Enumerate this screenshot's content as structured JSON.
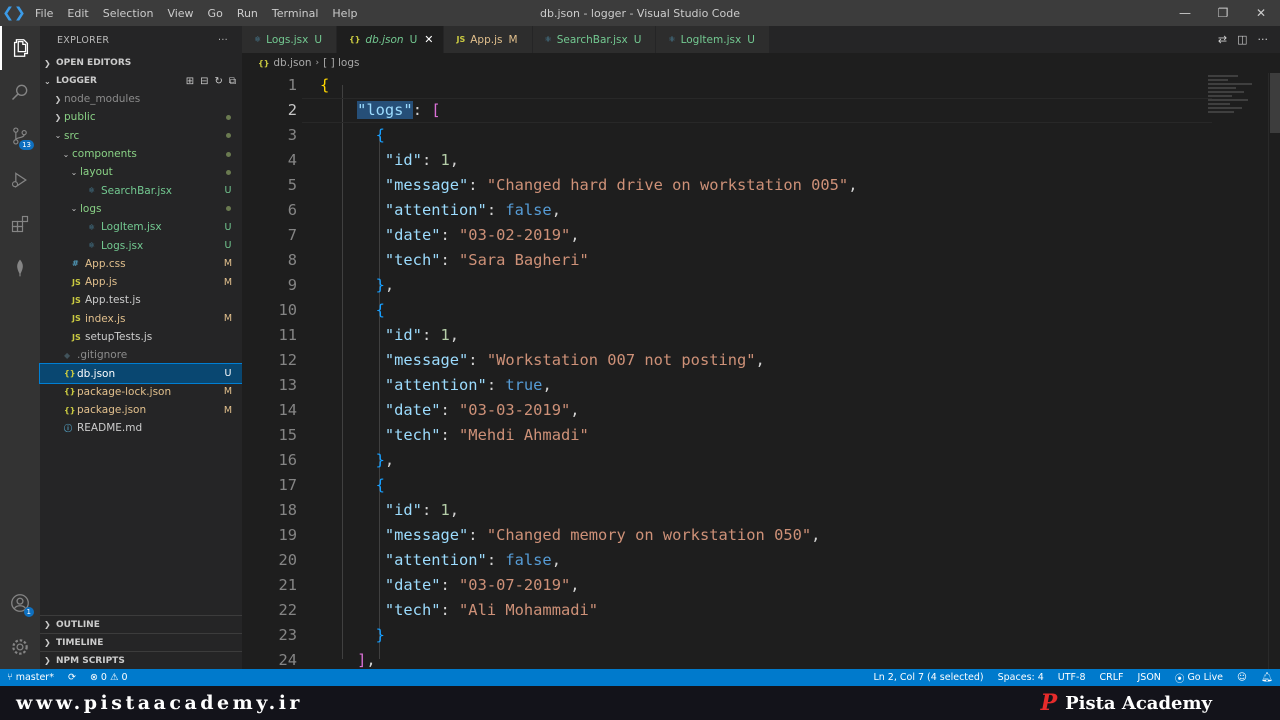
{
  "window": {
    "title": "db.json - logger - Visual Studio Code",
    "menu": [
      "File",
      "Edit",
      "Selection",
      "View",
      "Go",
      "Run",
      "Terminal",
      "Help"
    ]
  },
  "activity": {
    "scm_badge": "13",
    "accounts_badge": "1"
  },
  "sidebar": {
    "header": "EXPLORER",
    "open_editors": "OPEN EDITORS",
    "project": "LOGGER",
    "items": [
      {
        "name": "node_modules",
        "kind": "folder",
        "depth": 1,
        "open": false,
        "status": "",
        "icon": "",
        "dim": true
      },
      {
        "name": "public",
        "kind": "folder",
        "depth": 1,
        "open": false,
        "status": "dot",
        "icon": ""
      },
      {
        "name": "src",
        "kind": "folder",
        "depth": 1,
        "open": true,
        "status": "dot",
        "icon": ""
      },
      {
        "name": "components",
        "kind": "folder",
        "depth": 2,
        "open": true,
        "status": "dot",
        "icon": ""
      },
      {
        "name": "layout",
        "kind": "folder",
        "depth": 3,
        "open": true,
        "status": "dot",
        "icon": ""
      },
      {
        "name": "SearchBar.jsx",
        "kind": "file",
        "depth": 4,
        "status": "U",
        "icon": "⚛"
      },
      {
        "name": "logs",
        "kind": "folder",
        "depth": 3,
        "open": true,
        "status": "dot",
        "icon": ""
      },
      {
        "name": "LogItem.jsx",
        "kind": "file",
        "depth": 4,
        "status": "U",
        "icon": "⚛"
      },
      {
        "name": "Logs.jsx",
        "kind": "file",
        "depth": 4,
        "status": "U",
        "icon": "⚛"
      },
      {
        "name": "App.css",
        "kind": "file",
        "depth": 2,
        "status": "M",
        "icon": "#"
      },
      {
        "name": "App.js",
        "kind": "file",
        "depth": 2,
        "status": "M",
        "icon": "JS"
      },
      {
        "name": "App.test.js",
        "kind": "file",
        "depth": 2,
        "status": "",
        "icon": "JS"
      },
      {
        "name": "index.js",
        "kind": "file",
        "depth": 2,
        "status": "M",
        "icon": "JS"
      },
      {
        "name": "setupTests.js",
        "kind": "file",
        "depth": 2,
        "status": "",
        "icon": "JS"
      },
      {
        "name": ".gitignore",
        "kind": "file",
        "depth": 1,
        "status": "",
        "icon": "◆",
        "dim": true
      },
      {
        "name": "db.json",
        "kind": "file",
        "depth": 1,
        "status": "U",
        "icon": "{}",
        "selected": true
      },
      {
        "name": "package-lock.json",
        "kind": "file",
        "depth": 1,
        "status": "M",
        "icon": "{}"
      },
      {
        "name": "package.json",
        "kind": "file",
        "depth": 1,
        "status": "M",
        "icon": "{}"
      },
      {
        "name": "README.md",
        "kind": "file",
        "depth": 1,
        "status": "",
        "icon": "ⓘ"
      }
    ],
    "outline": "OUTLINE",
    "timeline": "TIMELINE",
    "npm": "NPM SCRIPTS"
  },
  "tabs": [
    {
      "name": "Logs.jsx",
      "status": "U",
      "icon": "⚛",
      "active": false
    },
    {
      "name": "db.json",
      "status": "U",
      "icon": "{}",
      "active": true
    },
    {
      "name": "App.js",
      "status": "M",
      "icon": "JS",
      "active": false
    },
    {
      "name": "SearchBar.jsx",
      "status": "U",
      "icon": "⚛",
      "active": false
    },
    {
      "name": "LogItem.jsx",
      "status": "U",
      "icon": "⚛",
      "active": false
    }
  ],
  "breadcrumb": {
    "file": "db.json",
    "symbol": "[ ] logs"
  },
  "editor": {
    "current_line": 2,
    "lines": [
      [
        [
          "b1",
          "{"
        ]
      ],
      [
        [
          "sp",
          "    "
        ],
        [
          "key",
          "\"logs\""
        ],
        [
          "p",
          ": "
        ],
        [
          "b2",
          "["
        ]
      ],
      [
        [
          "sp",
          "      "
        ],
        [
          "b3",
          "{"
        ]
      ],
      [
        [
          "sp",
          "       "
        ],
        [
          "key",
          "\"id\""
        ],
        [
          "p",
          ": "
        ],
        [
          "num",
          "1"
        ],
        [
          "p",
          ","
        ]
      ],
      [
        [
          "sp",
          "       "
        ],
        [
          "key",
          "\"message\""
        ],
        [
          "p",
          ": "
        ],
        [
          "str",
          "\"Changed hard drive on workstation 005\""
        ],
        [
          "p",
          ","
        ]
      ],
      [
        [
          "sp",
          "       "
        ],
        [
          "key",
          "\"attention\""
        ],
        [
          "p",
          ": "
        ],
        [
          "bool",
          "false"
        ],
        [
          "p",
          ","
        ]
      ],
      [
        [
          "sp",
          "       "
        ],
        [
          "key",
          "\"date\""
        ],
        [
          "p",
          ": "
        ],
        [
          "str",
          "\"03-02-2019\""
        ],
        [
          "p",
          ","
        ]
      ],
      [
        [
          "sp",
          "       "
        ],
        [
          "key",
          "\"tech\""
        ],
        [
          "p",
          ": "
        ],
        [
          "str",
          "\"Sara Bagheri\""
        ]
      ],
      [
        [
          "sp",
          "      "
        ],
        [
          "b3",
          "}"
        ],
        [
          "p",
          ","
        ]
      ],
      [
        [
          "sp",
          "      "
        ],
        [
          "b3",
          "{"
        ]
      ],
      [
        [
          "sp",
          "       "
        ],
        [
          "key",
          "\"id\""
        ],
        [
          "p",
          ": "
        ],
        [
          "num",
          "1"
        ],
        [
          "p",
          ","
        ]
      ],
      [
        [
          "sp",
          "       "
        ],
        [
          "key",
          "\"message\""
        ],
        [
          "p",
          ": "
        ],
        [
          "str",
          "\"Workstation 007 not posting\""
        ],
        [
          "p",
          ","
        ]
      ],
      [
        [
          "sp",
          "       "
        ],
        [
          "key",
          "\"attention\""
        ],
        [
          "p",
          ": "
        ],
        [
          "bool",
          "true"
        ],
        [
          "p",
          ","
        ]
      ],
      [
        [
          "sp",
          "       "
        ],
        [
          "key",
          "\"date\""
        ],
        [
          "p",
          ": "
        ],
        [
          "str",
          "\"03-03-2019\""
        ],
        [
          "p",
          ","
        ]
      ],
      [
        [
          "sp",
          "       "
        ],
        [
          "key",
          "\"tech\""
        ],
        [
          "p",
          ": "
        ],
        [
          "str",
          "\"Mehdi Ahmadi\""
        ]
      ],
      [
        [
          "sp",
          "      "
        ],
        [
          "b3",
          "}"
        ],
        [
          "p",
          ","
        ]
      ],
      [
        [
          "sp",
          "      "
        ],
        [
          "b3",
          "{"
        ]
      ],
      [
        [
          "sp",
          "       "
        ],
        [
          "key",
          "\"id\""
        ],
        [
          "p",
          ": "
        ],
        [
          "num",
          "1"
        ],
        [
          "p",
          ","
        ]
      ],
      [
        [
          "sp",
          "       "
        ],
        [
          "key",
          "\"message\""
        ],
        [
          "p",
          ": "
        ],
        [
          "str",
          "\"Changed memory on workstation 050\""
        ],
        [
          "p",
          ","
        ]
      ],
      [
        [
          "sp",
          "       "
        ],
        [
          "key",
          "\"attention\""
        ],
        [
          "p",
          ": "
        ],
        [
          "bool",
          "false"
        ],
        [
          "p",
          ","
        ]
      ],
      [
        [
          "sp",
          "       "
        ],
        [
          "key",
          "\"date\""
        ],
        [
          "p",
          ": "
        ],
        [
          "str",
          "\"03-07-2019\""
        ],
        [
          "p",
          ","
        ]
      ],
      [
        [
          "sp",
          "       "
        ],
        [
          "key",
          "\"tech\""
        ],
        [
          "p",
          ": "
        ],
        [
          "str",
          "\"Ali Mohammadi\""
        ]
      ],
      [
        [
          "sp",
          "      "
        ],
        [
          "b3",
          "}"
        ]
      ],
      [
        [
          "sp",
          "    "
        ],
        [
          "b2",
          "]"
        ],
        [
          "p",
          ","
        ]
      ]
    ]
  },
  "statusbar": {
    "branch": "master*",
    "errors": "0",
    "warnings": "0",
    "position": "Ln 2, Col 7 (4 selected)",
    "spaces": "Spaces: 4",
    "encoding": "UTF-8",
    "eol": "CRLF",
    "language": "JSON",
    "golive": "Go Live"
  },
  "watermark": {
    "site": "www.pistaacademy.ir",
    "brand": "Pista Academy"
  },
  "colors": {
    "accent": "#007acc",
    "selection": "#094771"
  }
}
